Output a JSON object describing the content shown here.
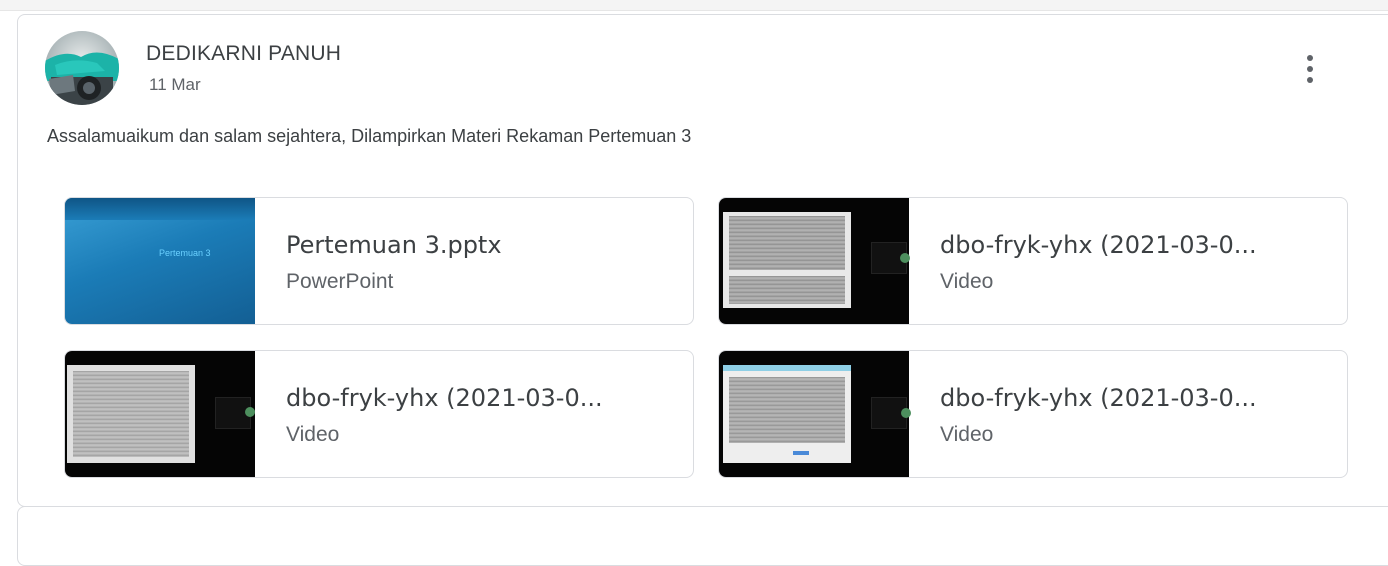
{
  "post": {
    "author": "DEDIKARNI PANUH",
    "date": "11 Mar",
    "text": "Assalamuaikum dan salam sejahtera, Dilampirkan Materi Rekaman Pertemuan 3"
  },
  "attachments": [
    {
      "title": "Pertemuan 3.pptx",
      "type": "PowerPoint",
      "thumb_label": "Pertemuan 3"
    },
    {
      "title": "dbo-fryk-yhx (2021-03-0...",
      "type": "Video"
    },
    {
      "title": "dbo-fryk-yhx (2021-03-0...",
      "type": "Video"
    },
    {
      "title": "dbo-fryk-yhx (2021-03-0...",
      "type": "Video"
    }
  ],
  "icons": {
    "menu": "more-vert-icon",
    "avatar": "user-avatar"
  },
  "colors": {
    "text_primary": "#3c4043",
    "text_secondary": "#5f6368",
    "border": "#dadce0",
    "ppt_thumb": "#1f7fb8",
    "video_thumb": "#050505"
  }
}
